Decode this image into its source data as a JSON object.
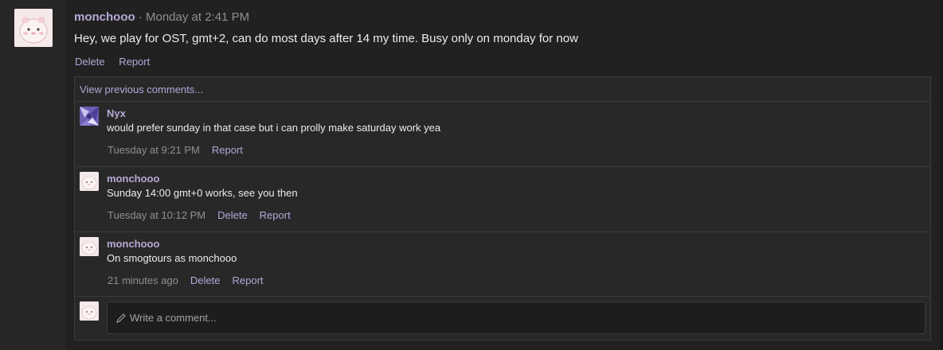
{
  "post": {
    "author": "monchooo",
    "separator": " · ",
    "time": "Monday at 2:41 PM",
    "text": "Hey, we play for OST, gmt+2, can do most days after 14 my time. Busy only on monday for now",
    "actions": [
      "Delete",
      "Report"
    ]
  },
  "comments": {
    "view_previous": "View previous comments...",
    "items": [
      {
        "author": "Nyx",
        "text": "would prefer sunday in that case but i can prolly make saturday work yea",
        "time": "Tuesday at 9:21 PM",
        "actions": [
          "Report"
        ],
        "avatar": "purple-art-avatar"
      },
      {
        "author": "monchooo",
        "text": "Sunday 14:00 gmt+0 works, see you then",
        "time": "Tuesday at 10:12 PM",
        "actions": [
          "Delete",
          "Report"
        ],
        "avatar": "pink-creature-avatar"
      },
      {
        "author": "monchooo",
        "text": "On smogtours as monchooo",
        "time": "21 minutes ago",
        "actions": [
          "Delete",
          "Report"
        ],
        "avatar": "pink-creature-avatar"
      }
    ],
    "write_placeholder": "Write a comment..."
  },
  "colors": {
    "author": "#b8a9d6",
    "link": "#b3a8d8",
    "muted": "#8f8f8f"
  }
}
